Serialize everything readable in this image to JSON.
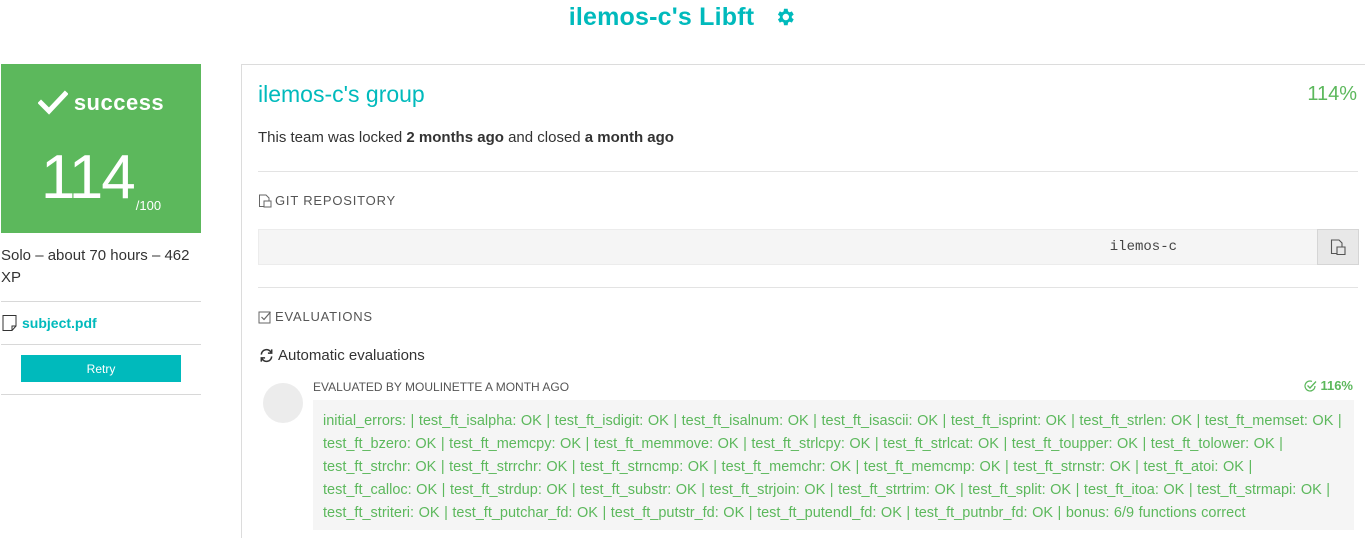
{
  "header": {
    "project_title": "ilemos-c's Libft",
    "settings_icon": "gear-icon"
  },
  "colors": {
    "accent": "#00babc",
    "success": "#5cb85c"
  },
  "status": {
    "label": "success",
    "score": "114",
    "score_max": "/100"
  },
  "sidebar": {
    "meta": "Solo – about 70 hours – 462 XP",
    "subject_link": "subject.pdf",
    "retry_label": "Retry"
  },
  "team": {
    "name": "ilemos-c's group",
    "percent": "114%",
    "lock_prefix": "This team was locked ",
    "locked_ago": "2 months ago",
    "lock_middle": " and closed ",
    "closed_ago": "a month ago"
  },
  "git": {
    "heading": "GIT REPOSITORY",
    "repo_value": "ilemos-c"
  },
  "evaluations": {
    "heading": "EVALUATIONS",
    "automatic_heading": "Automatic evaluations",
    "evaluated_by": "EVALUATED BY MOULINETTE A MONTH AGO",
    "percent": "116%",
    "result": "initial_errors: | test_ft_isalpha: OK | test_ft_isdigit: OK | test_ft_isalnum: OK | test_ft_isascii: OK | test_ft_isprint: OK | test_ft_strlen: OK | test_ft_memset: OK | test_ft_bzero: OK | test_ft_memcpy: OK | test_ft_memmove: OK | test_ft_strlcpy: OK | test_ft_strlcat: OK | test_ft_toupper: OK | test_ft_tolower: OK | test_ft_strchr: OK | test_ft_strrchr: OK | test_ft_strncmp: OK | test_ft_memchr: OK | test_ft_memcmp: OK | test_ft_strnstr: OK | test_ft_atoi: OK | test_ft_calloc: OK | test_ft_strdup: OK | test_ft_substr: OK | test_ft_strjoin: OK | test_ft_strtrim: OK | test_ft_split: OK | test_ft_itoa: OK | test_ft_strmapi: OK | test_ft_striteri: OK | test_ft_putchar_fd: OK | test_ft_putstr_fd: OK | test_ft_putendl_fd: OK | test_ft_putnbr_fd: OK | bonus: 6/9 functions correct"
  }
}
